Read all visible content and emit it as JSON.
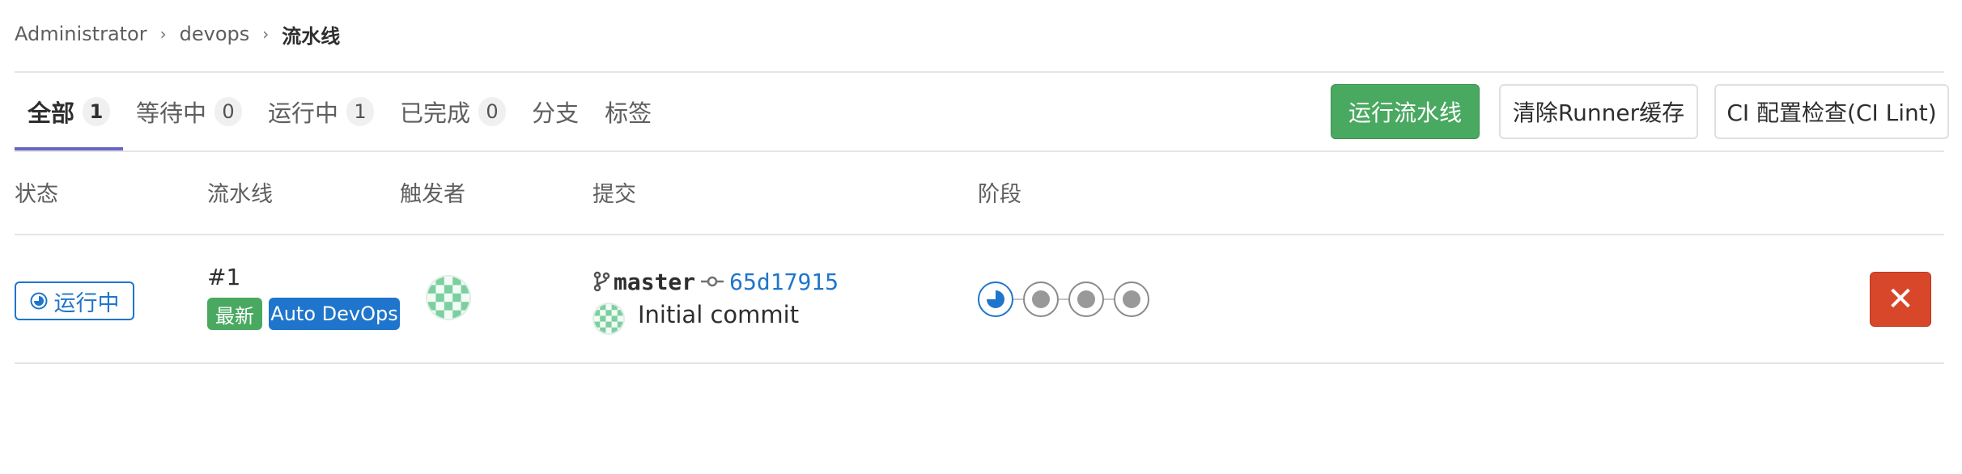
{
  "breadcrumb": {
    "items": [
      "Administrator",
      "devops"
    ],
    "current": "流水线"
  },
  "tabs": [
    {
      "label": "全部",
      "count": "1",
      "active": true
    },
    {
      "label": "等待中",
      "count": "0"
    },
    {
      "label": "运行中",
      "count": "1"
    },
    {
      "label": "已完成",
      "count": "0"
    },
    {
      "label": "分支"
    },
    {
      "label": "标签"
    }
  ],
  "actions": {
    "run_pipeline": "运行流水线",
    "clear_cache": "清除Runner缓存",
    "ci_lint": "CI 配置检查(CI Lint)"
  },
  "table": {
    "headers": {
      "status": "状态",
      "pipeline": "流水线",
      "triggerer": "触发者",
      "commit": "提交",
      "stages": "阶段"
    },
    "rows": [
      {
        "status": "运行中",
        "pipeline_id": "#1",
        "labels": {
          "latest": "最新",
          "auto_devops": "Auto DevOps"
        },
        "branch": "master",
        "sha": "65d17915",
        "commit_title": "Initial commit",
        "stages": [
          "running",
          "pending",
          "pending",
          "pending"
        ],
        "cancel": "✕"
      }
    ]
  },
  "colors": {
    "primary_blue": "#1f75cb",
    "success_green": "#4aa961",
    "danger_red": "#d9472b",
    "active_tab": "#6666c4"
  }
}
